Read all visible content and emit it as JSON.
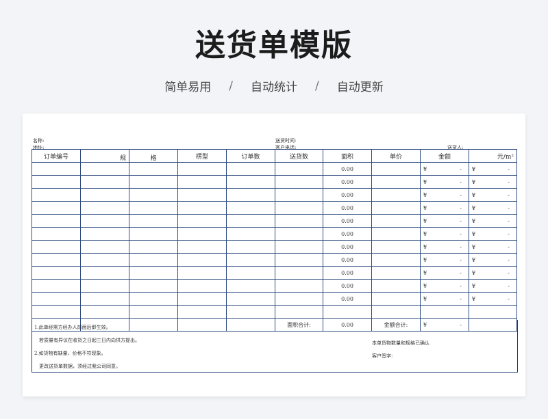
{
  "header": {
    "title": "送货单模版",
    "features": [
      "简单易用",
      "自动统计",
      "自动更新"
    ],
    "separator": "/"
  },
  "form": {
    "name_label": "名称:",
    "address_label": "地址:",
    "delivery_time_label": "送货时间:",
    "customer_phone_label": "客户电话:",
    "deliverer_label": "送货人:"
  },
  "table": {
    "columns": [
      "订单编号",
      "规",
      "格",
      "楞型",
      "订单数",
      "送货数",
      "面积",
      "单价",
      "金额",
      "元/m²"
    ],
    "rows": [
      {
        "area": "0.00",
        "amount_sym": "¥",
        "amount": "-",
        "unit_sym": "¥",
        "unit": "-"
      },
      {
        "area": "0.00",
        "amount_sym": "¥",
        "amount": "-",
        "unit_sym": "¥",
        "unit": "-"
      },
      {
        "area": "0.00",
        "amount_sym": "¥",
        "amount": "-",
        "unit_sym": "¥",
        "unit": "-"
      },
      {
        "area": "0.00",
        "amount_sym": "¥",
        "amount": "-",
        "unit_sym": "¥",
        "unit": "-"
      },
      {
        "area": "0.00",
        "amount_sym": "¥",
        "amount": "-",
        "unit_sym": "¥",
        "unit": "-"
      },
      {
        "area": "0.00",
        "amount_sym": "¥",
        "amount": "-",
        "unit_sym": "¥",
        "unit": "-"
      },
      {
        "area": "0.00",
        "amount_sym": "¥",
        "amount": "-",
        "unit_sym": "¥",
        "unit": "-"
      },
      {
        "area": "0.00",
        "amount_sym": "¥",
        "amount": "-",
        "unit_sym": "¥",
        "unit": "-"
      },
      {
        "area": "0.00",
        "amount_sym": "¥",
        "amount": "-",
        "unit_sym": "¥",
        "unit": "-"
      },
      {
        "area": "0.00",
        "amount_sym": "¥",
        "amount": "-",
        "unit_sym": "¥",
        "unit": "-"
      },
      {
        "area": "0.00",
        "amount_sym": "¥",
        "amount": "-",
        "unit_sym": "¥",
        "unit": "-"
      },
      {
        "area": "",
        "amount_sym": "",
        "amount": "",
        "unit_sym": "",
        "unit": ""
      }
    ],
    "totals": {
      "area_label": "面积合计:",
      "area_value": "0.00",
      "amount_label": "金额合计:",
      "amount_sym": "¥",
      "amount_value": "-"
    }
  },
  "notes": {
    "line1": "1.此单经需方经办人前面后即生效。",
    "line2": "若质量有异议在收货之日起三日内向供方提出。",
    "line3": "2.如货物有缺量、价格不符现象。",
    "line4": "更改送货单数据，须经过我公司同意。",
    "confirm": "本单货物数量和规格已确认",
    "signature": "客户签字:"
  }
}
